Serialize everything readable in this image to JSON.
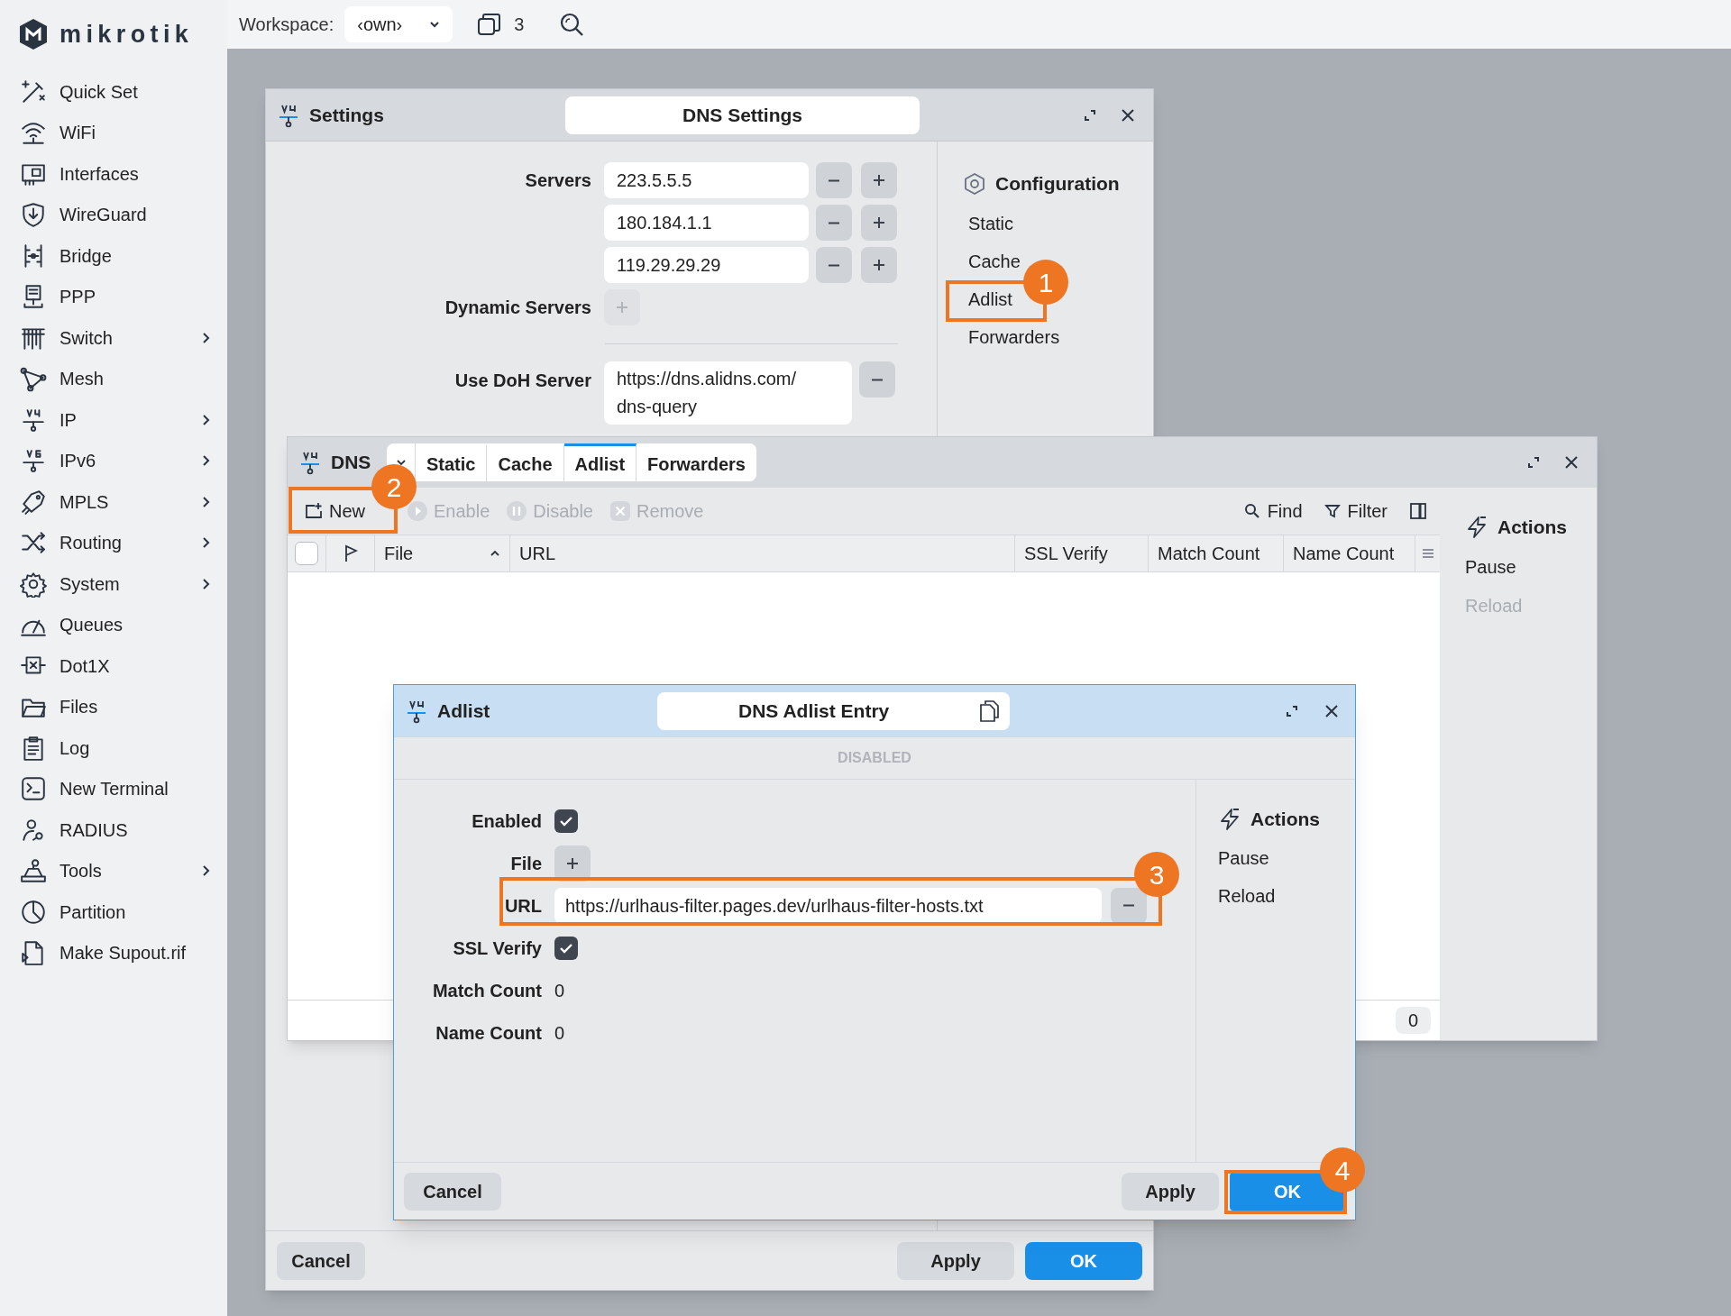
{
  "brand": "mikrotik",
  "topbar": {
    "workspace_label": "Workspace:",
    "workspace_value": "‹own›",
    "window_count": "3"
  },
  "sidebar": {
    "items": [
      {
        "label": "Quick Set",
        "has_submenu": false
      },
      {
        "label": "WiFi",
        "has_submenu": false
      },
      {
        "label": "Interfaces",
        "has_submenu": false
      },
      {
        "label": "WireGuard",
        "has_submenu": false
      },
      {
        "label": "Bridge",
        "has_submenu": false
      },
      {
        "label": "PPP",
        "has_submenu": false
      },
      {
        "label": "Switch",
        "has_submenu": true
      },
      {
        "label": "Mesh",
        "has_submenu": false
      },
      {
        "label": "IP",
        "has_submenu": true
      },
      {
        "label": "IPv6",
        "has_submenu": true
      },
      {
        "label": "MPLS",
        "has_submenu": true
      },
      {
        "label": "Routing",
        "has_submenu": true
      },
      {
        "label": "System",
        "has_submenu": true
      },
      {
        "label": "Queues",
        "has_submenu": false
      },
      {
        "label": "Dot1X",
        "has_submenu": false
      },
      {
        "label": "Files",
        "has_submenu": false
      },
      {
        "label": "Log",
        "has_submenu": false
      },
      {
        "label": "New Terminal",
        "has_submenu": false
      },
      {
        "label": "RADIUS",
        "has_submenu": false
      },
      {
        "label": "Tools",
        "has_submenu": true
      },
      {
        "label": "Partition",
        "has_submenu": false
      },
      {
        "label": "Make Supout.rif",
        "has_submenu": false
      }
    ]
  },
  "settings_window": {
    "title": "Settings",
    "heading": "DNS Settings",
    "servers_label": "Servers",
    "servers": [
      "223.5.5.5",
      "180.184.1.1",
      "119.29.29.29"
    ],
    "dynamic_servers_label": "Dynamic Servers",
    "doh_label": "Use DoH Server",
    "doh_value_lines": [
      "https://dns.alidns.com/",
      "dns-query"
    ],
    "nav": {
      "heading": "Configuration",
      "items": [
        "Static",
        "Cache",
        "Adlist",
        "Forwarders"
      ]
    },
    "buttons": [
      "Cancel",
      "Apply",
      "OK"
    ]
  },
  "dns_window": {
    "title": "DNS",
    "tabs": [
      {
        "label": "Static",
        "selected": false
      },
      {
        "label": "Cache",
        "selected": false
      },
      {
        "label": "Adlist",
        "selected": true
      },
      {
        "label": "Forwarders",
        "selected": false
      }
    ],
    "toolbar": [
      {
        "label": "New",
        "disabled": false
      },
      {
        "label": "Enable",
        "disabled": true
      },
      {
        "label": "Disable",
        "disabled": true
      },
      {
        "label": "Remove",
        "disabled": true
      }
    ],
    "select_all_checked": false,
    "find": "Find",
    "filter": "Filter",
    "columns": [
      "File",
      "URL",
      "SSL Verify",
      "Match Count",
      "Name Count"
    ],
    "actions": {
      "heading": "Actions",
      "items": [
        {
          "label": "Pause",
          "disabled": false
        },
        {
          "label": "Reload",
          "disabled": true
        }
      ]
    },
    "footer_count": "0"
  },
  "adlist_dialog": {
    "title": "Adlist",
    "heading": "DNS Adlist Entry",
    "status": "DISABLED",
    "fields": [
      {
        "kind": "checkbox",
        "label": "Enabled",
        "checked": true
      },
      {
        "kind": "add",
        "label": "File"
      },
      {
        "kind": "text",
        "label": "URL",
        "value": "https://urlhaus-filter.pages.dev/urlhaus-filter-hosts.txt"
      },
      {
        "kind": "checkbox",
        "label": "SSL Verify",
        "checked": true
      },
      {
        "kind": "readonly",
        "label": "Match Count",
        "value": "0"
      },
      {
        "kind": "readonly",
        "label": "Name Count",
        "value": "0"
      }
    ],
    "actions": {
      "heading": "Actions",
      "items": [
        {
          "label": "Pause",
          "disabled": false
        },
        {
          "label": "Reload",
          "disabled": false
        }
      ]
    },
    "buttons": [
      "Cancel",
      "Apply",
      "OK"
    ]
  },
  "callouts": [
    "1",
    "2",
    "3",
    "4"
  ]
}
